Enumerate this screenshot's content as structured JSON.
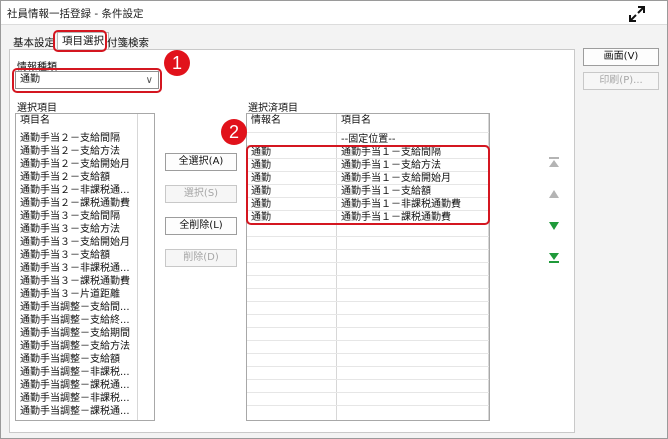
{
  "window": {
    "title": "社員情報一括登録 - 条件設定"
  },
  "tabs": [
    {
      "label": "基本設定"
    },
    {
      "label": "項目選択"
    },
    {
      "label": "付箋検索"
    }
  ],
  "info_type": {
    "label": "情報種類",
    "value": "通勤"
  },
  "available": {
    "label": "選択項目",
    "header": "項目名",
    "items": [
      "通勤手当２－支給間隔",
      "通勤手当２－支給方法",
      "通勤手当２－支給開始月",
      "通勤手当２－支給額",
      "通勤手当２－非課税通...",
      "通勤手当２－課税通勤費",
      "通勤手当３－支給間隔",
      "通勤手当３－支給方法",
      "通勤手当３－支給開始月",
      "通勤手当３－支給額",
      "通勤手当３－非課税通...",
      "通勤手当３－課税通勤費",
      "通勤手当３－片道距離",
      "通勤手当調整－支給間...",
      "通勤手当調整－支給終...",
      "通勤手当調整－支給期間",
      "通勤手当調整－支給方法",
      "通勤手当調整－支給額",
      "通勤手当調整－非課税...",
      "通勤手当調整－課税通...",
      "通勤手当調整－非課税...",
      "通勤手当調整－課税通..."
    ]
  },
  "middle_buttons": {
    "select_all": "全選択(A)",
    "select": "選択(S)",
    "delete_all": "全削除(L)",
    "delete": "削除(D)"
  },
  "selected": {
    "label": "選択済項目",
    "header_info": "情報名",
    "header_item": "項目名",
    "fixed_row": "--固定位置--",
    "rows": [
      {
        "info": "通勤",
        "item": "通勤手当１－支給間隔"
      },
      {
        "info": "通勤",
        "item": "通勤手当１－支給方法"
      },
      {
        "info": "通勤",
        "item": "通勤手当１－支給開始月"
      },
      {
        "info": "通勤",
        "item": "通勤手当１－支給額"
      },
      {
        "info": "通勤",
        "item": "通勤手当１－非課税通勤費"
      },
      {
        "info": "通勤",
        "item": "通勤手当１－課税通勤費"
      }
    ]
  },
  "right_buttons": {
    "screen": "画面(V)",
    "print": "印刷(P)..."
  },
  "callouts": {
    "one": "1",
    "two": "2"
  },
  "icons": {
    "expand": "expand-arrows-icon",
    "move_top": "move-top-icon",
    "move_up": "move-up-icon",
    "move_down": "move-down-icon",
    "move_bottom": "move-bottom-icon"
  },
  "colors": {
    "callout_red": "#e1121b",
    "arrow_green": "#1f9a3a",
    "arrow_gray": "#b4b4b4"
  }
}
